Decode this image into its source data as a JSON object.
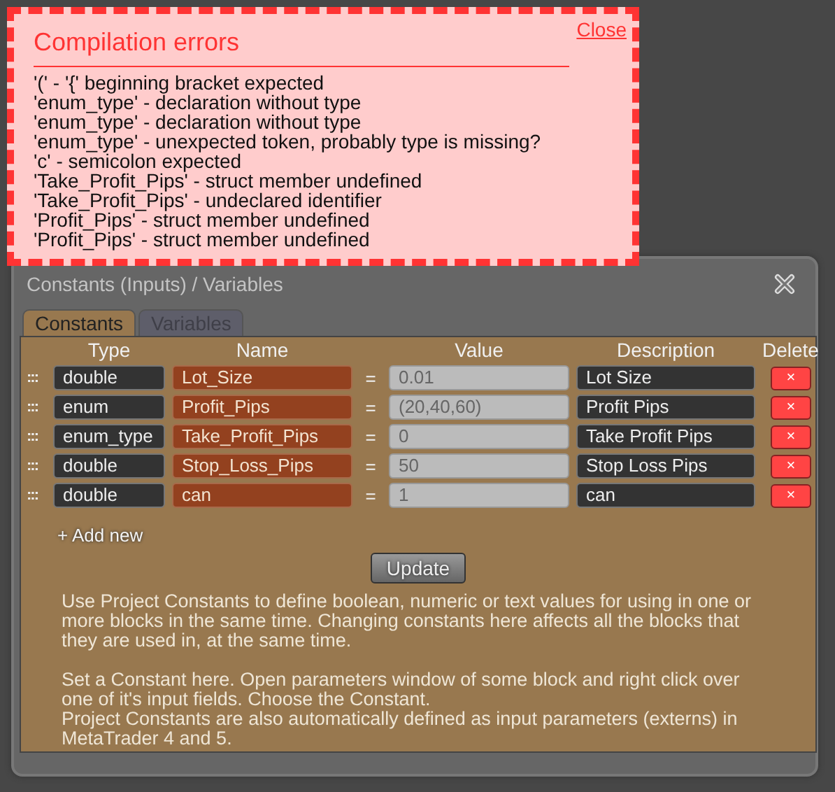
{
  "error_popup": {
    "title": "Compilation errors",
    "close": "Close",
    "errors": [
      "'(' - '{' beginning bracket expected",
      "'enum_type' - declaration without type",
      "'enum_type' - declaration without type",
      "'enum_type' - unexpected token, probably type is missing?",
      "'c' - semicolon expected",
      "'Take_Profit_Pips' - struct member undefined",
      "'Take_Profit_Pips' - undeclared identifier",
      "'Profit_Pips' - struct member undefined",
      "'Profit_Pips' - struct member undefined"
    ]
  },
  "window": {
    "title": "Constants (Inputs) / Variables"
  },
  "tabs": [
    {
      "label": "Constants",
      "selected": true
    },
    {
      "label": "Variables",
      "selected": false
    }
  ],
  "table": {
    "columns": [
      "Type",
      "Name",
      "Value",
      "Description",
      "Delete"
    ],
    "rows": [
      {
        "handle": ":::",
        "type": "double",
        "name": "Lot_Size",
        "equals": "=",
        "value": "0.01",
        "description": "Lot Size",
        "delete": "×"
      },
      {
        "handle": ":::",
        "type": "enum",
        "name": "Profit_Pips",
        "equals": "=",
        "value": "(20,40,60)",
        "description": "Profit Pips",
        "delete": "×"
      },
      {
        "handle": ":::",
        "type": "enum_type",
        "name": "Take_Profit_Pips",
        "equals": "=",
        "value": "0",
        "description": "Take Profit Pips",
        "delete": "×"
      },
      {
        "handle": ":::",
        "type": "double",
        "name": "Stop_Loss_Pips",
        "equals": "=",
        "value": "50",
        "description": "Stop Loss Pips",
        "delete": "×"
      },
      {
        "handle": ":::",
        "type": "double",
        "name": "can",
        "equals": "=",
        "value": "1",
        "description": "can",
        "delete": "×"
      }
    ]
  },
  "add_new": "+ Add new",
  "update_button": "Update",
  "help_paragraphs": [
    "Use Project Constants to define boolean, numeric or text values for using in one or more blocks in the same time. Changing constants here affects all the blocks that they are used in, at the same time.",
    "Set a Constant here. Open parameters window of some block and right click over one of it's input fields. Choose the Constant.",
    "Project Constants are also automatically defined as input parameters (externs) in MetaTrader 4 and 5."
  ]
}
